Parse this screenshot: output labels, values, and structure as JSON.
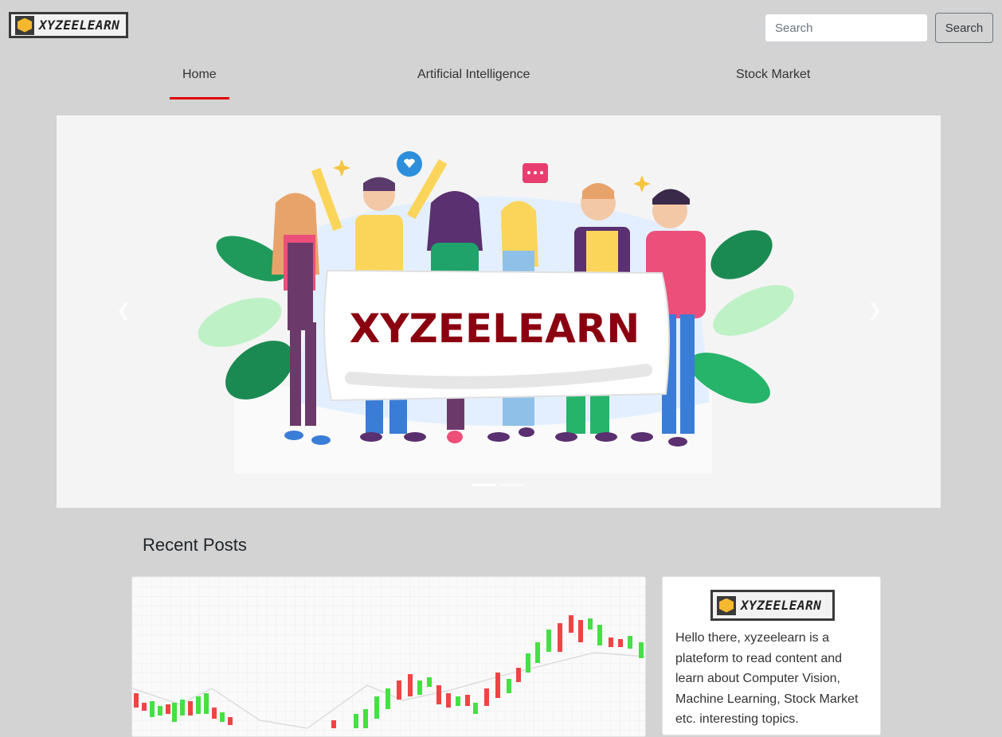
{
  "brand": {
    "logo_text": "XYZEELEARN"
  },
  "search": {
    "placeholder": "Search",
    "button_label": "Search"
  },
  "nav": {
    "items": [
      {
        "label": "Home"
      },
      {
        "label": "Artificial Intelligence"
      },
      {
        "label": "Stock Market"
      }
    ]
  },
  "hero": {
    "banner_text": "XYZEELEARN",
    "slides": 2,
    "active_slide": 1
  },
  "recent_posts": {
    "title": "Recent Posts"
  },
  "about": {
    "logo_text": "XYZEELEARN",
    "text": "Hello there, xyzeelearn is a plateform to read content and learn about Computer Vision, Machine Learning, Stock Market etc. interesting topics."
  },
  "colors": {
    "accent": "#e00000",
    "banner_text": "#8b0010",
    "page_bg": "#d3d3d3"
  }
}
